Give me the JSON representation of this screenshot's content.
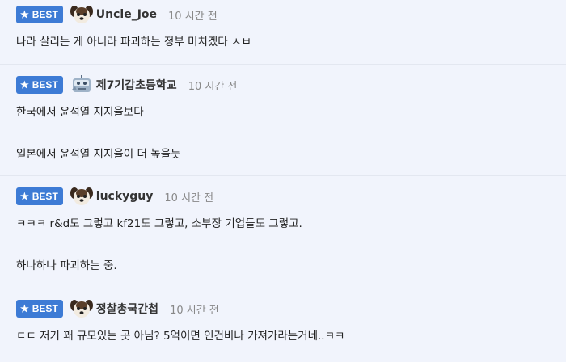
{
  "comments": [
    {
      "badge": "BEST",
      "avatar": "dog-avatar-icon",
      "username": "Uncle_Joe",
      "time": "10 시간 전",
      "lines": [
        "나라 살리는 게 아니라 파괴하는 정부 미치겠다 ㅅㅂ"
      ]
    },
    {
      "badge": "BEST",
      "avatar": "robot-avatar-icon",
      "username": "제7기갑초등학교",
      "time": "10 시간 전",
      "lines": [
        "한국에서 윤석열 지지율보다",
        "",
        "일본에서 윤석열 지지율이 더 높을듯"
      ]
    },
    {
      "badge": "BEST",
      "avatar": "dog-avatar-icon",
      "username": "luckyguy",
      "time": "10 시간 전",
      "lines": [
        "ㅋㅋㅋ r&d도 그렇고 kf21도 그렇고, 소부장 기업들도 그렇고.",
        "",
        "하나하나 파괴하는 중."
      ]
    },
    {
      "badge": "BEST",
      "avatar": "dog-avatar-icon",
      "username": "정찰총국간첩",
      "time": "10 시간 전",
      "lines": [
        "ㄷㄷ 저기 꽤 규모있는 곳 아님? 5억이면 인건비나 가져가라는거네..ㅋㅋ"
      ]
    }
  ],
  "colors": {
    "badge_bg": "#3d7bd5",
    "background": "#f1f4fc",
    "username": "#333333",
    "time": "#888888"
  }
}
